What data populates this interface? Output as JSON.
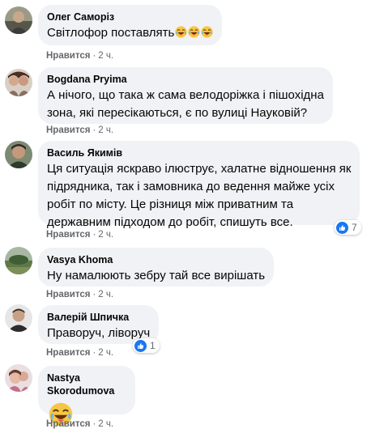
{
  "comments": [
    {
      "author": "Олег Саморіз",
      "text": "Світлофор поставлять",
      "emoji": [
        "crying-laughing-face-icon",
        "crying-laughing-face-icon",
        "crying-laughing-face-icon"
      ],
      "like_label": "Нравится",
      "time": "2 ч."
    },
    {
      "author": "Bogdana Pryima",
      "text_lines": [
        "А нічого, що така ж сама велодоріжка і пішохідна",
        "зона, які пересікаються, є по вулиці Науковій?"
      ],
      "like_label": "Нравится",
      "time": "2 ч."
    },
    {
      "author": "Василь Якимів",
      "text_lines": [
        "Ця ситуація яскраво ілюструє, халатне відношення як",
        "підрядника, так і замовника до ведення майже усіх",
        "робіт по місту. Це різниця між приватним та",
        "державним підходом до робіт, спишуть все."
      ],
      "like_label": "Нравится",
      "time": "2 ч.",
      "reaction_count": "7"
    },
    {
      "author": "Vasya Khoma",
      "text": "Ну намалюють зебру тай все вирішать",
      "like_label": "Нравится",
      "time": "2 ч."
    },
    {
      "author": "Валерій Шпичка",
      "text": "Праворуч, ліворуч",
      "like_label": "Нравится",
      "time": "2 ч.",
      "reaction_count": "1"
    },
    {
      "author": "Nastya Skorodumova",
      "emoji": [
        "crying-laughing-face-icon"
      ],
      "like_label": "Нравится",
      "time": "2 ч."
    }
  ],
  "colors": {
    "bubble": "#f0f2f5",
    "meta_text": "#65676b",
    "like_blue": "#1877f2",
    "emoji_yellow": "#f7c644"
  }
}
